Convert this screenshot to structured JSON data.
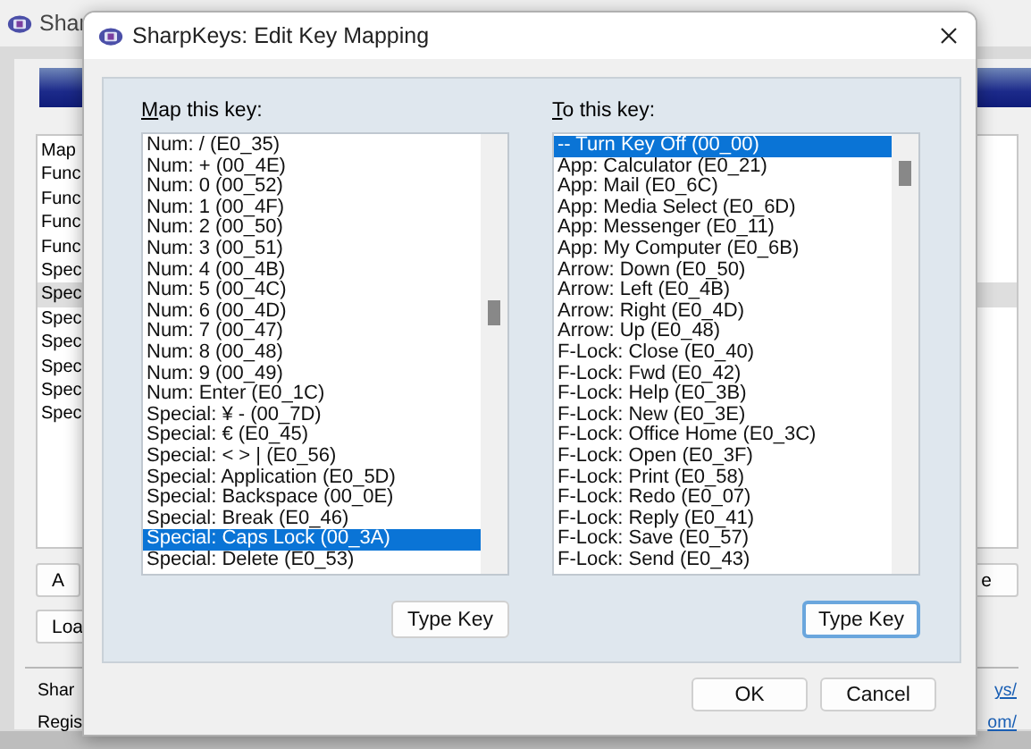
{
  "main_window": {
    "title": "Shar",
    "list_rows": [
      {
        "text": "Map",
        "selected": false
      },
      {
        "text": "Func",
        "selected": false
      },
      {
        "text": "Func",
        "selected": false
      },
      {
        "text": "Func",
        "selected": false
      },
      {
        "text": "Func",
        "selected": false
      },
      {
        "text": "Spec",
        "selected": false
      },
      {
        "text": "Spec",
        "selected": true
      },
      {
        "text": "Spec",
        "selected": false
      },
      {
        "text": "Spec",
        "selected": false
      },
      {
        "text": "Spec",
        "selected": false
      },
      {
        "text": "Spec",
        "selected": false
      },
      {
        "text": "Spec",
        "selected": false
      }
    ],
    "buttons": [
      "A",
      "Loa"
    ],
    "right_button": "e",
    "footer": [
      {
        "text": "Shar",
        "link": "ys/"
      },
      {
        "text": "Regis",
        "link": "om/"
      }
    ]
  },
  "dialog": {
    "title": "SharpKeys: Edit Key Mapping",
    "from": {
      "label": "Map this key:",
      "button": "Type Key",
      "focused": false,
      "items": [
        {
          "text": "Num: / (E0_35)",
          "selected": false
        },
        {
          "text": "Num: + (00_4E)",
          "selected": false
        },
        {
          "text": "Num: 0 (00_52)",
          "selected": false
        },
        {
          "text": "Num: 1 (00_4F)",
          "selected": false
        },
        {
          "text": "Num: 2 (00_50)",
          "selected": false
        },
        {
          "text": "Num: 3 (00_51)",
          "selected": false
        },
        {
          "text": "Num: 4 (00_4B)",
          "selected": false
        },
        {
          "text": "Num: 5 (00_4C)",
          "selected": false
        },
        {
          "text": "Num: 6 (00_4D)",
          "selected": false
        },
        {
          "text": "Num: 7 (00_47)",
          "selected": false
        },
        {
          "text": "Num: 8 (00_48)",
          "selected": false
        },
        {
          "text": "Num: 9 (00_49)",
          "selected": false
        },
        {
          "text": "Num: Enter (E0_1C)",
          "selected": false
        },
        {
          "text": "Special: ¥ - (00_7D)",
          "selected": false
        },
        {
          "text": "Special: € (E0_45)",
          "selected": false
        },
        {
          "text": "Special: < > | (E0_56)",
          "selected": false
        },
        {
          "text": "Special: Application (E0_5D)",
          "selected": false
        },
        {
          "text": "Special: Backspace (00_0E)",
          "selected": false
        },
        {
          "text": "Special: Break (E0_46)",
          "selected": false
        },
        {
          "text": "Special: Caps Lock (00_3A)",
          "selected": true
        },
        {
          "text": "Special: Delete (E0_53)",
          "selected": false
        }
      ]
    },
    "to": {
      "label": "To this key:",
      "button": "Type Key",
      "focused": true,
      "items": [
        {
          "text": "-- Turn Key Off (00_00)",
          "selected": true
        },
        {
          "text": "App: Calculator (E0_21)",
          "selected": false
        },
        {
          "text": "App: Mail (E0_6C)",
          "selected": false
        },
        {
          "text": "App: Media Select (E0_6D)",
          "selected": false
        },
        {
          "text": "App: Messenger (E0_11)",
          "selected": false
        },
        {
          "text": "App: My Computer (E0_6B)",
          "selected": false
        },
        {
          "text": "Arrow: Down (E0_50)",
          "selected": false
        },
        {
          "text": "Arrow: Left (E0_4B)",
          "selected": false
        },
        {
          "text": "Arrow: Right (E0_4D)",
          "selected": false
        },
        {
          "text": "Arrow: Up (E0_48)",
          "selected": false
        },
        {
          "text": "F-Lock: Close (E0_40)",
          "selected": false
        },
        {
          "text": "F-Lock: Fwd (E0_42)",
          "selected": false
        },
        {
          "text": "F-Lock: Help (E0_3B)",
          "selected": false
        },
        {
          "text": "F-Lock: New (E0_3E)",
          "selected": false
        },
        {
          "text": "F-Lock: Office Home (E0_3C)",
          "selected": false
        },
        {
          "text": "F-Lock: Open (E0_3F)",
          "selected": false
        },
        {
          "text": "F-Lock: Print (E0_58)",
          "selected": false
        },
        {
          "text": "F-Lock: Redo (E0_07)",
          "selected": false
        },
        {
          "text": "F-Lock: Reply (E0_41)",
          "selected": false
        },
        {
          "text": "F-Lock: Save (E0_57)",
          "selected": false
        },
        {
          "text": "F-Lock: Send (E0_43)",
          "selected": false
        }
      ]
    },
    "buttons": [
      "OK",
      "Cancel"
    ]
  }
}
